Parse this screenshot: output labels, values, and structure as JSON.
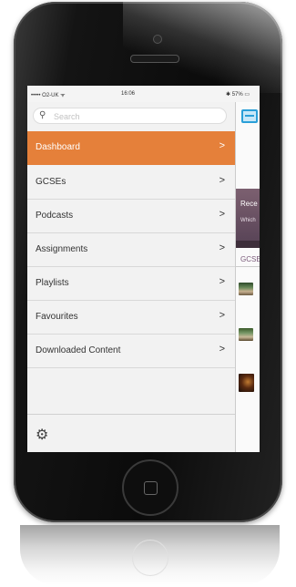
{
  "status_bar": {
    "carrier": "••••• O2-UK ᯤ",
    "time": "16:06",
    "battery": "✱ 57% ▭"
  },
  "search": {
    "placeholder": "Search"
  },
  "menu": {
    "items": [
      {
        "label": "Dashboard",
        "active": true
      },
      {
        "label": "GCSEs"
      },
      {
        "label": "Podcasts"
      },
      {
        "label": "Assignments"
      },
      {
        "label": "Playlists"
      },
      {
        "label": "Favourites"
      },
      {
        "label": "Downloaded Content"
      }
    ],
    "chevron": ">",
    "settings_icon": "gear-icon"
  },
  "right_panel": {
    "banner_title": "Rece",
    "banner_sub": "Which",
    "section_label": "GCSE"
  },
  "colors": {
    "accent": "#e5803a",
    "panel_button": "#2a9fd8",
    "banner": "#6e5466"
  }
}
